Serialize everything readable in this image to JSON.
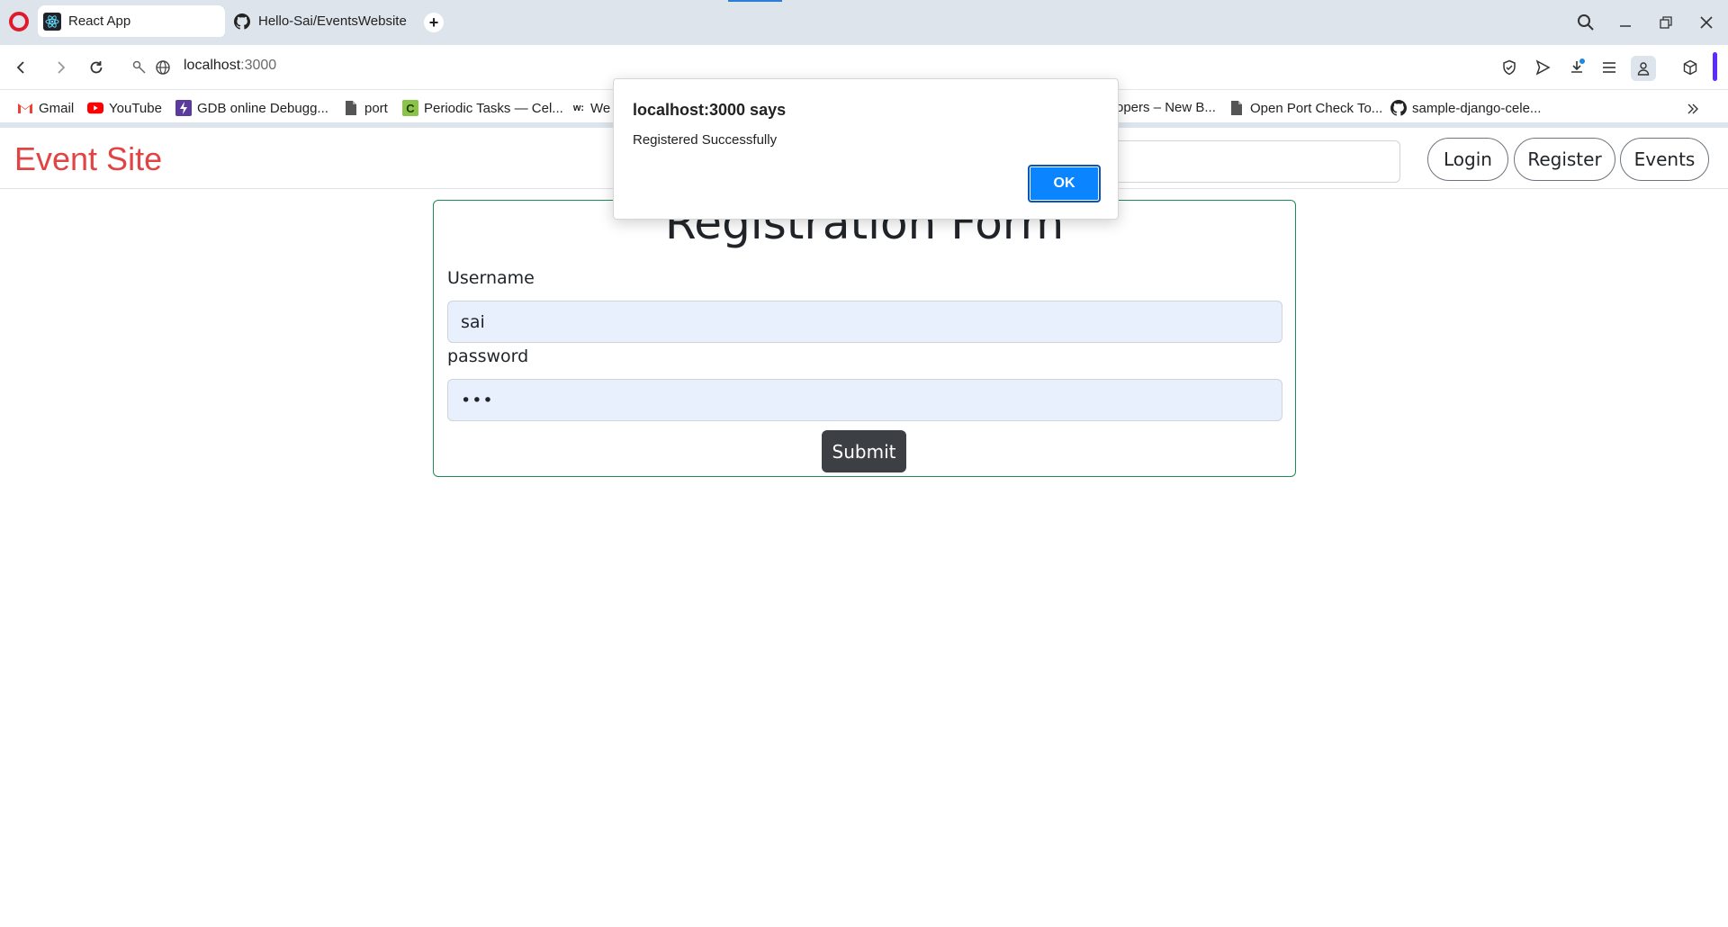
{
  "browser": {
    "tabs": [
      {
        "title": "React App",
        "active": true
      },
      {
        "title": "Hello-Sai/EventsWebsite",
        "active": false
      }
    ],
    "url": {
      "host": "localhost",
      "port": ":3000"
    },
    "bookmarks": [
      {
        "label": "Gmail",
        "icon": "gmail-icon"
      },
      {
        "label": "YouTube",
        "icon": "youtube-icon"
      },
      {
        "label": "GDB online Debugg...",
        "icon": "gdb-icon"
      },
      {
        "label": "port",
        "icon": "document-icon"
      },
      {
        "label": "Periodic Tasks — Cel...",
        "icon": "celery-icon"
      },
      {
        "label": "We",
        "icon": "w-icon"
      },
      {
        "label": "opers – New B...",
        "icon": "document-icon"
      },
      {
        "label": "Open Port Check To...",
        "icon": "document-icon"
      },
      {
        "label": "sample-django-cele...",
        "icon": "github-icon"
      }
    ]
  },
  "page": {
    "brand": "Event Site",
    "nav_buttons": {
      "login": "Login",
      "register": "Register",
      "events": "Events"
    },
    "form": {
      "title": "Registration Form",
      "username_label": "Username",
      "username_value": "sai",
      "password_label": "password",
      "password_value": "•••",
      "submit_label": "Submit"
    }
  },
  "dialog": {
    "title": "localhost:3000 says",
    "message": "Registered Successfully",
    "ok_label": "OK"
  },
  "colors": {
    "brand": "#e04444",
    "form_border": "#1f8a5a",
    "submit_bg": "#3c4045",
    "ok_bg": "#0a84ff",
    "input_bg": "#e8f0fe"
  }
}
